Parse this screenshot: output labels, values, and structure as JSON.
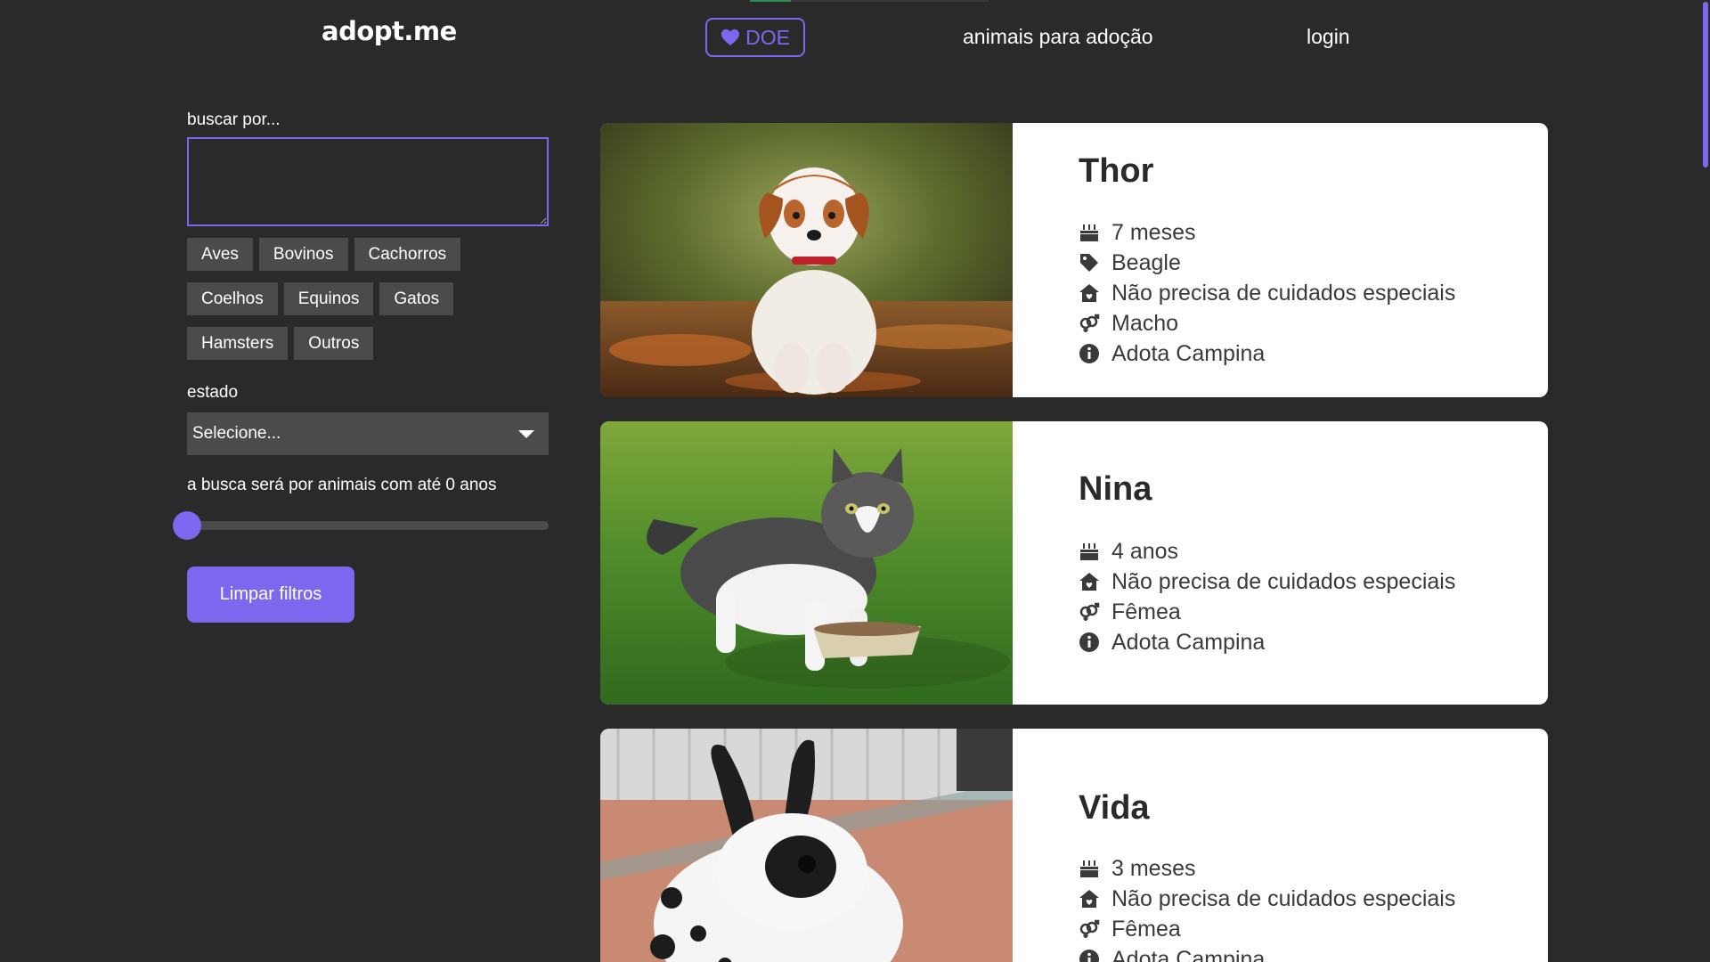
{
  "header": {
    "logo": "adopt.me",
    "donate_label": "DOE",
    "nav_adopt": "animais para adoção",
    "nav_login": "login"
  },
  "filters": {
    "search_label": "buscar por...",
    "search_value": "",
    "categories": [
      "Aves",
      "Bovinos",
      "Cachorros",
      "Coelhos",
      "Equinos",
      "Gatos",
      "Hamsters",
      "Outros"
    ],
    "state_label": "estado",
    "state_selected": "Selecione...",
    "age_label": "a busca será por animais com até 0 anos",
    "age_value": 0,
    "clear_label": "Limpar filtros"
  },
  "pets": [
    {
      "name": "Thor",
      "age": "7 meses",
      "breed": "Beagle",
      "care": "Não precisa de cuidados especiais",
      "sex": "Macho",
      "org": "Adota Campina"
    },
    {
      "name": "Nina",
      "age": "4 anos",
      "care": "Não precisa de cuidados especiais",
      "sex": "Fêmea",
      "org": "Adota Campina"
    },
    {
      "name": "Vida",
      "age": "3 meses",
      "care": "Não precisa de cuidados especiais",
      "sex": "Fêmea",
      "org": "Adota Campina"
    }
  ],
  "colors": {
    "background": "#2a2a2b",
    "accent": "#7b68ee",
    "chip": "#4b4b4d",
    "card": "#ffffff"
  },
  "icons": {
    "donate": "heart-icon",
    "age": "birthday-cake-icon",
    "breed": "tag-icon",
    "care": "house-heart-icon",
    "sex": "venus-mars-icon",
    "org": "info-circle-icon"
  }
}
